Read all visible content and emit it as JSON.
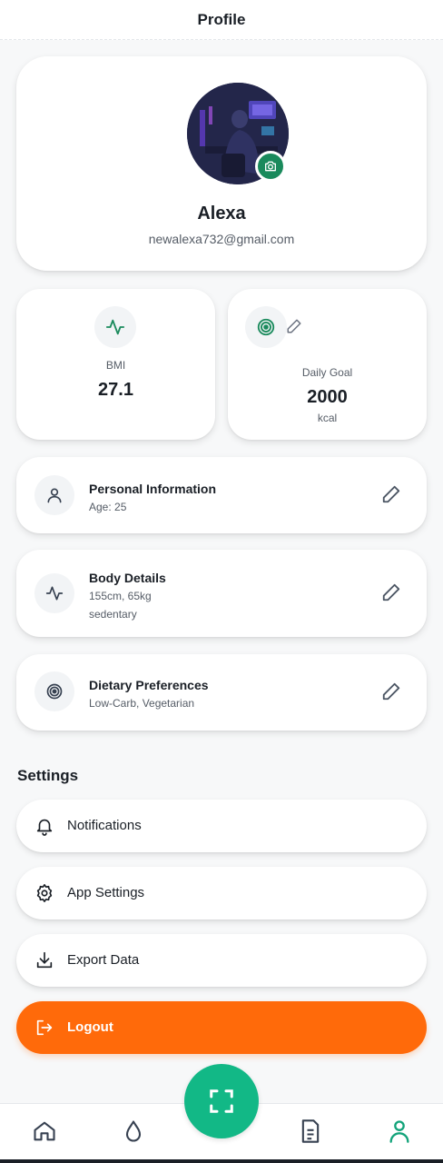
{
  "header": {
    "title": "Profile"
  },
  "profile": {
    "name": "Alexa",
    "email": "newalexa732@gmail.com"
  },
  "stats": {
    "bmi": {
      "label": "BMI",
      "value": "27.1"
    },
    "daily_goal": {
      "label": "Daily Goal",
      "value": "2000",
      "unit": "kcal"
    }
  },
  "info_cards": [
    {
      "title": "Personal Information",
      "lines": [
        "Age: 25"
      ]
    },
    {
      "title": "Body Details",
      "lines": [
        "155cm, 65kg",
        "sedentary"
      ]
    },
    {
      "title": "Dietary Preferences",
      "lines": [
        "Low-Carb, Vegetarian"
      ]
    }
  ],
  "settings": {
    "title": "Settings",
    "items": [
      {
        "label": "Notifications",
        "icon": "bell-icon"
      },
      {
        "label": "App Settings",
        "icon": "gear-icon"
      },
      {
        "label": "Export Data",
        "icon": "download-icon"
      }
    ],
    "logout_label": "Logout"
  },
  "bottom_nav": {
    "items": [
      "home-icon",
      "water-drop-icon",
      "scan-icon",
      "document-icon",
      "user-icon"
    ],
    "active": "user-icon"
  },
  "colors": {
    "accent_green": "#1a8a5c",
    "fab_green": "#12b886",
    "logout_orange": "#ff6a0a",
    "active_nav": "#12a37a"
  }
}
